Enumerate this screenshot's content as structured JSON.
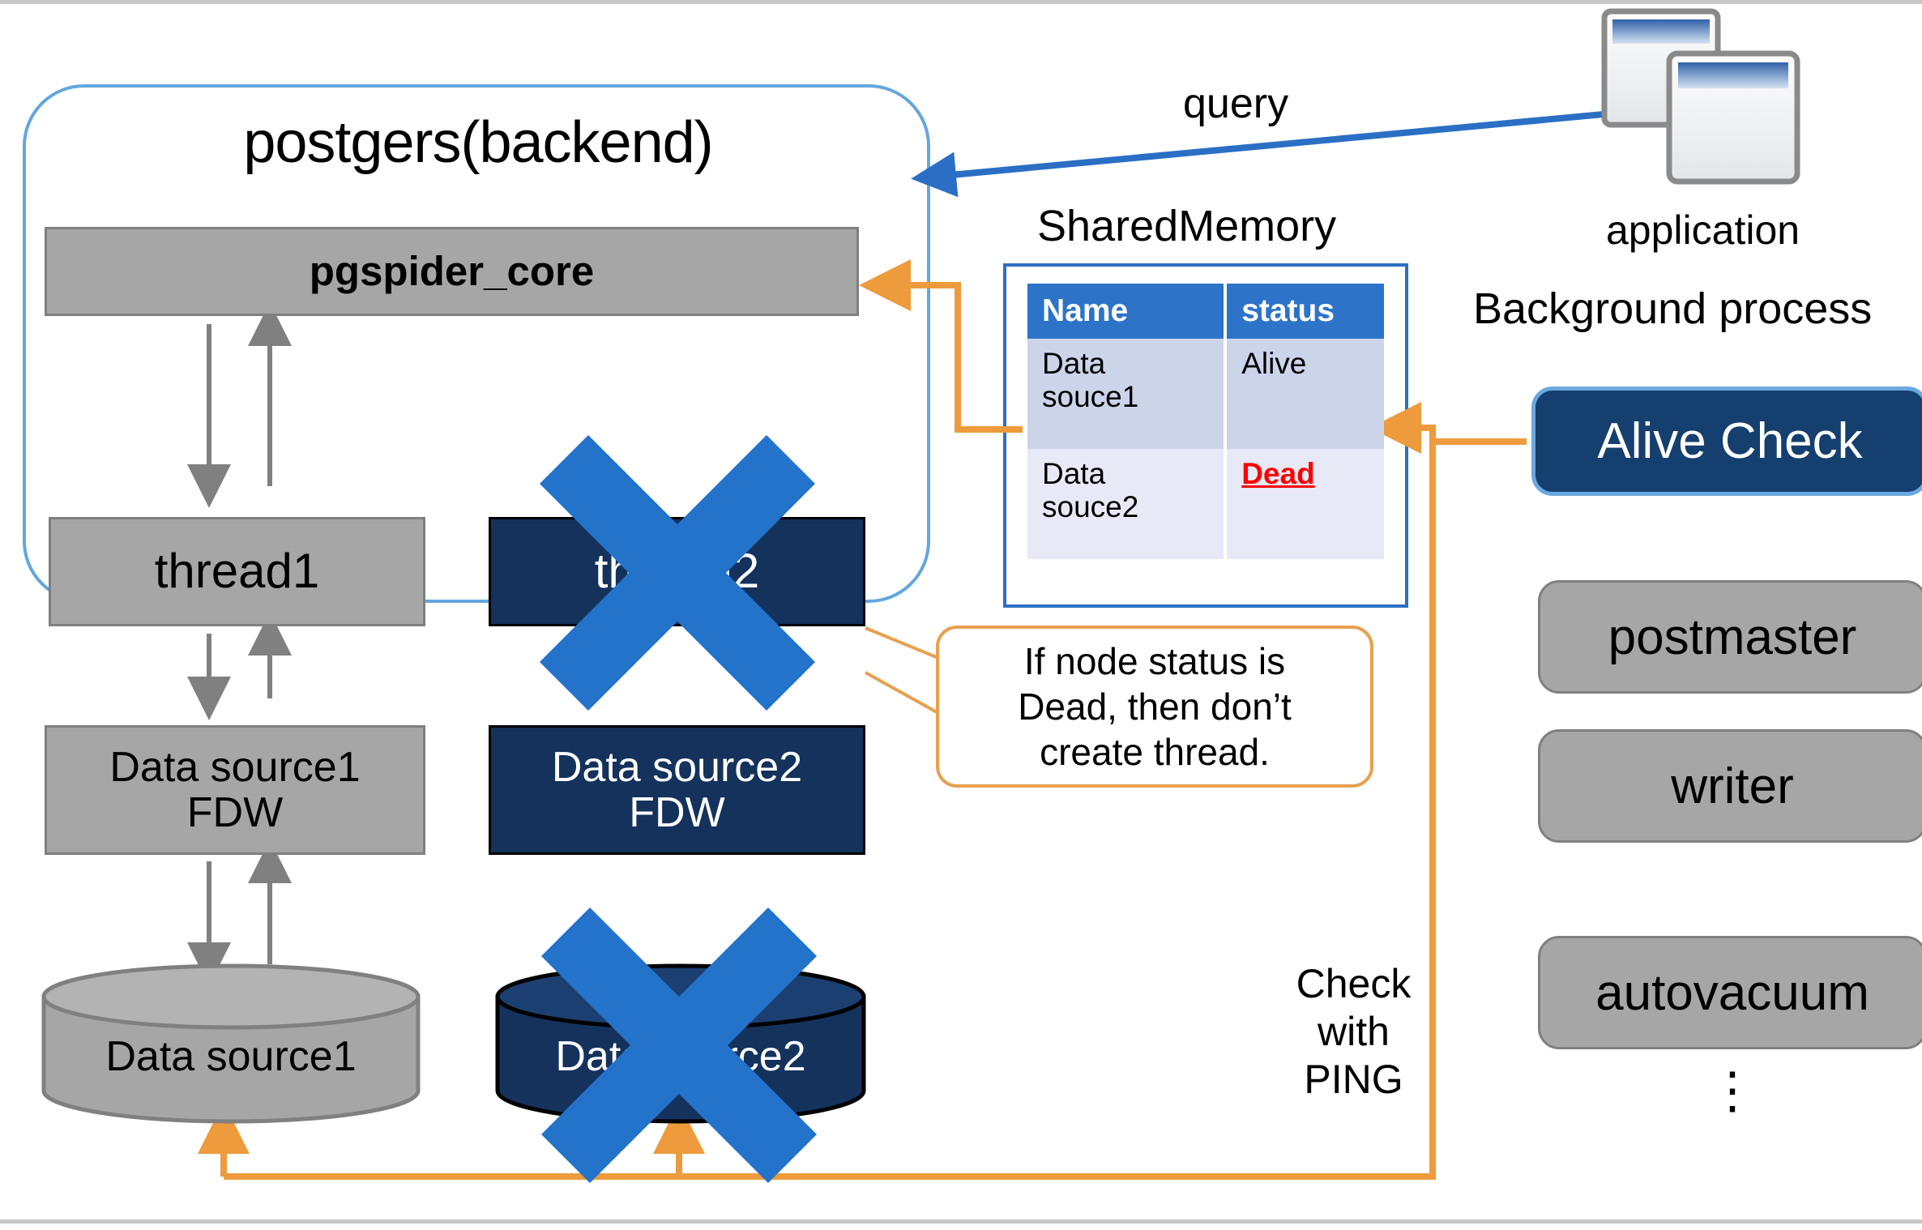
{
  "backend": {
    "title": "postgers(backend)",
    "core_label": "pgspider_core",
    "thread1_label": "thread1",
    "thread2_label": "thread2",
    "ds1_fdw_line1": "Data source1",
    "ds1_fdw_line2": "FDW",
    "ds2_fdw_line1": "Data source2",
    "ds2_fdw_line2": "FDW"
  },
  "datastores": {
    "ds1_label": "Data source1",
    "ds2_label": "Data source2"
  },
  "labels": {
    "query": "query",
    "shared_memory": "SharedMemory",
    "application": "application",
    "background_process": "Background process",
    "check_with_ping": "Check with PING"
  },
  "shared_memory_table": {
    "headers": [
      "Name",
      "status"
    ],
    "rows": [
      {
        "name_line1": "Data",
        "name_line2": "souce1",
        "status": "Alive",
        "status_state": "alive"
      },
      {
        "name_line1": "Data",
        "name_line2": "souce2",
        "status": "Dead",
        "status_state": "dead"
      }
    ]
  },
  "callout": {
    "line1": "If node status is",
    "line2": "Dead, then don’t",
    "line3": "create thread."
  },
  "background_processes": {
    "alive_check": "Alive Check",
    "postmaster": "postmaster",
    "writer": "writer",
    "autovacuum": "autovacuum",
    "ellipsis": "⋮"
  },
  "colors": {
    "backend_border": "#64a6dd",
    "gray_fill": "#a6a6a6",
    "navy_fill": "#14325c",
    "orange_line": "#ed9b3c",
    "blue_arrow": "#2a6fc4",
    "blue_x": "#2473ca",
    "table_header": "#2d73c8",
    "dead_red": "#ff0000",
    "alive_check_fill": "#153f6e",
    "alive_check_border": "#6aa9e0"
  },
  "icons": {
    "application": "application-windows-icon",
    "cylinder1": "database-cylinder-icon",
    "cylinder2": "database-cylinder-icon",
    "cross1": "blue-x-cross-icon",
    "cross2": "blue-x-cross-icon"
  }
}
